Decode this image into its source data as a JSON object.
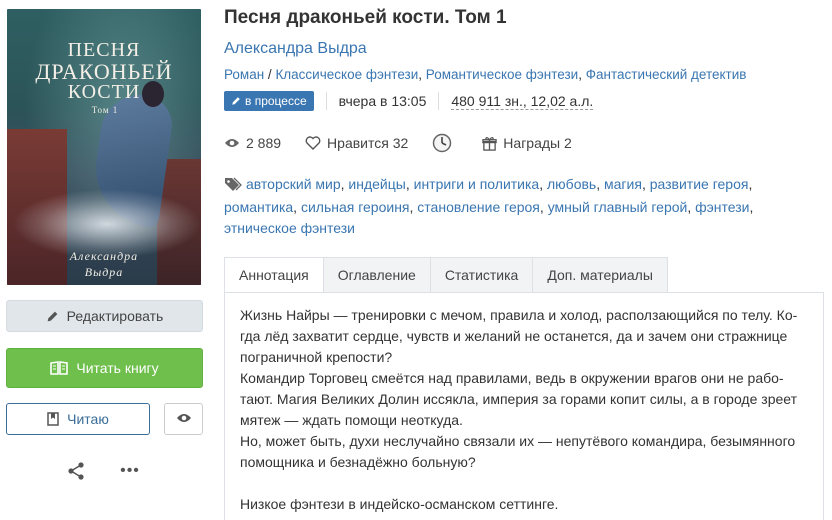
{
  "cover": {
    "title_lines": [
      "ПЕСНЯ",
      "ДРАКОНЬЕЙ",
      "КОСТИ"
    ],
    "volume": "Том 1",
    "author_lines": [
      "Александра",
      "Выдра"
    ]
  },
  "actions": {
    "edit_label": "Редактировать",
    "read_label": "Читать книгу",
    "reading_label": "Читаю",
    "more_label": "•••"
  },
  "book": {
    "title": "Песня драконьей кости. Том 1",
    "author": "Александра Выдра",
    "genres": [
      "Роман",
      "Классическое фэнтези",
      "Романтическое фэнтези",
      "Фантастический детектив"
    ],
    "status": "в процессе",
    "updated": "вчера в 13:05",
    "size": "480 911 зн., 12,02 а.л."
  },
  "stats": {
    "views": "2 889",
    "likes": "Нравится 32",
    "awards": "Награды 2"
  },
  "tags": [
    "авторский мир",
    "индейцы",
    "интриги и политика",
    "любовь",
    "магия",
    "развитие героя",
    "романтика",
    "сильная героиня",
    "становление героя",
    "умный главный герой",
    "фэнтези",
    "этническое фэнтези"
  ],
  "tabs": [
    "Аннотация",
    "Оглавление",
    "Статистика",
    "Доп. материалы"
  ],
  "annotation": {
    "p1_line1": "Жизнь Найры — тренировки с мечом, правила и холод, расползающийся по телу. Ко-",
    "p1_line2": "гда лёд захватит сердце, чувств и желаний не останется, да и зачем они стражнице",
    "p1_line3": "пограничной крепости?",
    "p2_line1": "Командир Торговец смеётся над правилами, ведь в окружении врагов они не рабо-",
    "p2_line2": "тают. Магия Великих Долин иссякла, империя за горами копит силы, а в городе зреет",
    "p2_line3": "мятеж — ждать помощи неоткуда.",
    "p3_line1": "Но, может быть, духи неслучайно связали их — непутёвого командира, безымянного",
    "p3_line2": "помощника и безнадёжно больную?",
    "p4_line1": "Низкое фэнтези в индейско-османском сеттинге."
  }
}
